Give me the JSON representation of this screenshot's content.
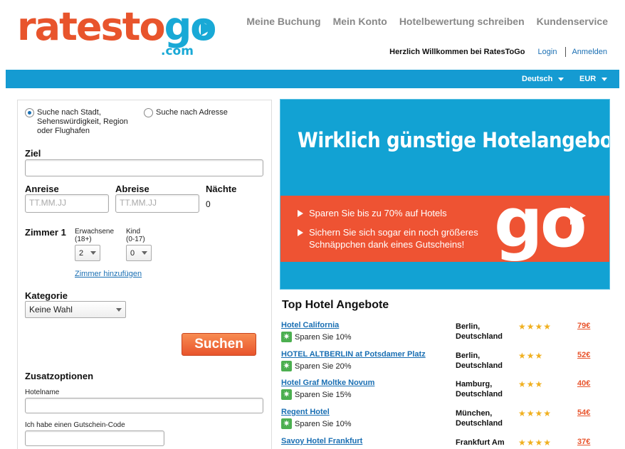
{
  "logo": {
    "rates": "rates",
    "to": "to",
    "go": "go",
    "com": ".com"
  },
  "topnav": [
    "Meine Buchung",
    "Mein Konto",
    "Hotelbewertung schreiben",
    "Kundenservice"
  ],
  "welcome": {
    "text": "Herzlich Willkommen bei RatesToGo",
    "login": "Login",
    "register": "Anmelden"
  },
  "bar": {
    "language": "Deutsch",
    "currency": "EUR"
  },
  "search": {
    "radio1": "Suche nach Stadt, Sehenswürdigkeit, Region oder Flughafen",
    "radio2": "Suche nach Adresse",
    "ziel_label": "Ziel",
    "ziel_value": "",
    "anreise_label": "Anreise",
    "anreise_placeholder": "TT.MM.JJ",
    "abreise_label": "Abreise",
    "abreise_placeholder": "TT.MM.JJ",
    "naechte_label": "Nächte",
    "naechte_value": "0",
    "zimmer_label": "Zimmer 1",
    "erwachsene_label": "Erwachsene",
    "erwachsene_sub": "(18+)",
    "erwachsene_value": "2",
    "kind_label": "Kind",
    "kind_sub": "(0-17)",
    "kind_value": "0",
    "add_room": "Zimmer hinzufügen",
    "kategorie_label": "Kategorie",
    "kategorie_value": "Keine Wahl",
    "submit": "Suchen",
    "zusatz_label": "Zusatzoptionen",
    "hotelname_label": "Hotelname",
    "gutschein_label": "Ich habe einen Gutschein-Code"
  },
  "banner": {
    "title": "Wirklich günstige Hotelangebote",
    "bullet1": "Sparen Sie bis zu 70% auf Hotels",
    "bullet2_line1": "Sichern Sie sich sogar ein noch größeres",
    "bullet2_line2": "Schnäppchen dank eines Gutscheins!",
    "go": "go"
  },
  "offers": {
    "title": "Top Hotel Angebote",
    "items": [
      {
        "name": "Hotel California",
        "save": "Sparen Sie 10%",
        "city1": "Berlin,",
        "city2": "Deutschland",
        "stars": "★★★★",
        "price": "79€"
      },
      {
        "name": "HOTEL ALTBERLIN at Potsdamer Platz",
        "save": "Sparen Sie 20%",
        "city1": "Berlin,",
        "city2": "Deutschland",
        "stars": "★★★",
        "price": "52€"
      },
      {
        "name": "Hotel Graf Moltke Novum",
        "save": "Sparen Sie 15%",
        "city1": "Hamburg,",
        "city2": "Deutschland",
        "stars": "★★★",
        "price": "40€"
      },
      {
        "name": "Regent Hotel",
        "save": "Sparen Sie 10%",
        "city1": "München,",
        "city2": "Deutschland",
        "stars": "★★★★",
        "price": "54€"
      },
      {
        "name": "Savoy Hotel Frankfurt",
        "save": "",
        "city1": "Frankfurt Am",
        "city2": "",
        "stars": "★★★★",
        "price": "37€"
      }
    ]
  }
}
